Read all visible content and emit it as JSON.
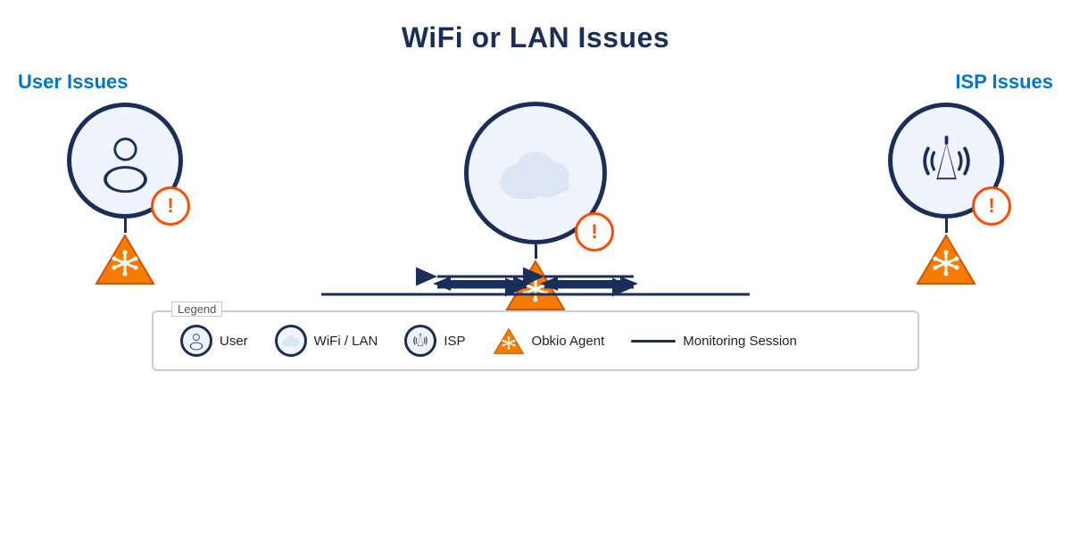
{
  "title": "WiFi or LAN Issues",
  "sections": {
    "left": {
      "label": "User Issues"
    },
    "right": {
      "label": "ISP Issues"
    }
  },
  "legend": {
    "title": "Legend",
    "items": [
      {
        "key": "user",
        "label": "User"
      },
      {
        "key": "wifi-lan",
        "label": "WiFi / LAN"
      },
      {
        "key": "isp",
        "label": "ISP"
      },
      {
        "key": "agent",
        "label": "Obkio Agent"
      },
      {
        "key": "session",
        "label": "Monitoring Session"
      }
    ]
  },
  "colors": {
    "navy": "#1a2e5a",
    "blue": "#0077cc",
    "orange": "#f57c00",
    "orange_fill": "#ff9800",
    "error_red": "#ff4d00",
    "bg_circle": "#f0f4ff"
  }
}
